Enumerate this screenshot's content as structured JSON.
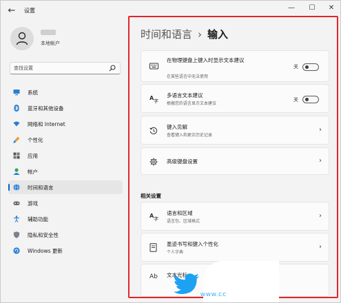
{
  "window": {
    "title": "设置",
    "back_icon": "back-arrow-icon",
    "controls": {
      "minimize": "—",
      "maximize": "☐",
      "close": "✕"
    }
  },
  "profile": {
    "account_type": "本地帐户"
  },
  "search": {
    "placeholder": "查找设置",
    "icon": "search-icon"
  },
  "sidebar": {
    "items": [
      {
        "label": "系统",
        "icon": "monitor-icon",
        "active": false
      },
      {
        "label": "蓝牙和其他设备",
        "icon": "bluetooth-icon",
        "active": false
      },
      {
        "label": "网络和 Internet",
        "icon": "wifi-icon",
        "active": false
      },
      {
        "label": "个性化",
        "icon": "brush-icon",
        "active": false
      },
      {
        "label": "应用",
        "icon": "apps-icon",
        "active": false
      },
      {
        "label": "帐户",
        "icon": "person-icon",
        "active": false
      },
      {
        "label": "时间和语言",
        "icon": "globe-clock-icon",
        "active": true
      },
      {
        "label": "游戏",
        "icon": "gamepad-icon",
        "active": false
      },
      {
        "label": "辅助功能",
        "icon": "accessibility-icon",
        "active": false
      },
      {
        "label": "隐私和安全性",
        "icon": "shield-icon",
        "active": false
      },
      {
        "label": "Windows 更新",
        "icon": "update-icon",
        "active": false
      }
    ]
  },
  "breadcrumb": {
    "parent": "时间和语言",
    "separator": "›",
    "current": "输入"
  },
  "cards": {
    "physical_keyboard": {
      "title": "在物理键盘上键入时显示文本建议",
      "subtitle": "在某些语言中无法使用",
      "toggle_label": "关",
      "toggle_on": false,
      "icon": "keyboard-icon"
    },
    "multilingual": {
      "title": "多语言文本建议",
      "subtitle": "根据您的语言显示文本建议",
      "toggle_label": "关",
      "toggle_on": false,
      "icon": "multilingual-icon"
    },
    "typing_insights": {
      "title": "键入见解",
      "subtitle": "查看键入和更正历史记录",
      "icon": "history-icon"
    },
    "advanced_keyboard": {
      "title": "高级键盘设置",
      "icon": "gear-icon"
    }
  },
  "related": {
    "section_title": "相关设置",
    "items": {
      "language_region": {
        "title": "语言和区域",
        "subtitle": "语言包、区域格式",
        "icon": "language-icon"
      },
      "pen_typing": {
        "title": "墨迹书写和键入个性化",
        "subtitle": "个人字典",
        "icon": "pen-notebook-icon"
      },
      "text_cursor": {
        "title": "文本光标",
        "icon": "text-cursor-icon",
        "icon_text": "Ab"
      }
    }
  },
  "watermark": {
    "text": "WWW.CC",
    "icon": "twitter-bird-icon"
  },
  "colors": {
    "accent": "#0067c0",
    "annotation_border": "#e3242b",
    "watermark": "#1da1f2"
  }
}
